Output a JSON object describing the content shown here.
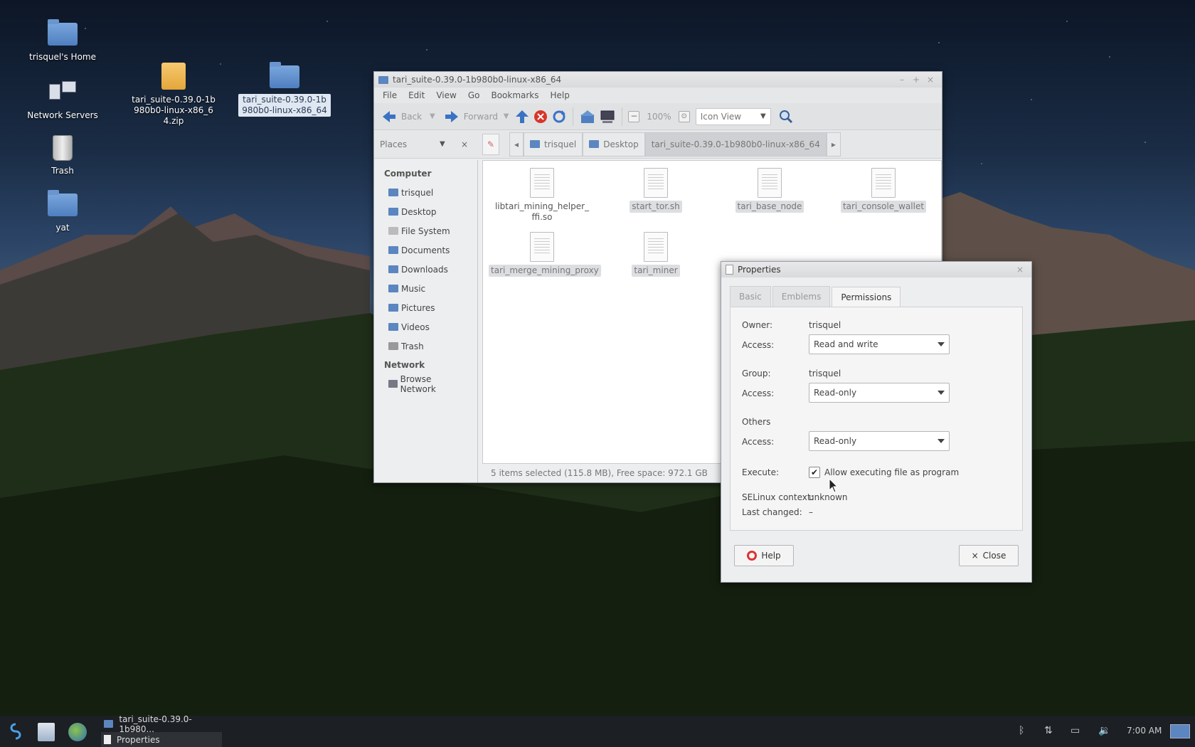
{
  "desktop": {
    "icons": [
      {
        "label": "trisquel's Home"
      },
      {
        "label": "Network Servers"
      },
      {
        "label": "Trash"
      },
      {
        "label": "yat"
      },
      {
        "label": "tari_suite-0.39.0-1b980b0-linux-x86_64.zip"
      },
      {
        "label": "tari_suite-0.39.0-1b980b0-linux-x86_64"
      }
    ]
  },
  "filemanager": {
    "title": "tari_suite-0.39.0-1b980b0-linux-x86_64",
    "menu": [
      "File",
      "Edit",
      "View",
      "Go",
      "Bookmarks",
      "Help"
    ],
    "toolbar": {
      "back": "Back",
      "forward": "Forward",
      "zoom": "100%",
      "view_mode": "Icon View"
    },
    "places_label": "Places",
    "breadcrumbs": [
      "trisquel",
      "Desktop",
      "tari_suite-0.39.0-1b980b0-linux-x86_64"
    ],
    "sidebar": {
      "computer_heading": "Computer",
      "computer_items": [
        "trisquel",
        "Desktop",
        "File System",
        "Documents",
        "Downloads",
        "Music",
        "Pictures",
        "Videos",
        "Trash"
      ],
      "network_heading": "Network",
      "network_items": [
        "Browse Network"
      ]
    },
    "files": [
      {
        "name": "libtari_mining_helper_ffi.so",
        "selected": false
      },
      {
        "name": "start_tor.sh",
        "selected": true
      },
      {
        "name": "tari_base_node",
        "selected": true
      },
      {
        "name": "tari_console_wallet",
        "selected": true
      },
      {
        "name": "tari_merge_mining_proxy",
        "selected": true
      },
      {
        "name": "tari_miner",
        "selected": true
      }
    ],
    "status": "5 items selected (115.8 MB), Free space: 972.1 GB"
  },
  "properties": {
    "title": "Properties",
    "tabs": [
      "Basic",
      "Emblems",
      "Permissions"
    ],
    "active_tab": "Permissions",
    "owner_label": "Owner:",
    "owner": "trisquel",
    "access_label": "Access:",
    "owner_access": "Read and write",
    "group_label": "Group:",
    "group": "trisquel",
    "group_access": "Read-only",
    "others_label": "Others",
    "others_access": "Read-only",
    "execute_label": "Execute:",
    "execute_text": "Allow executing file as program",
    "execute_checked": true,
    "selinux_label": "SELinux context:",
    "selinux": "unknown",
    "last_changed_label": "Last changed:",
    "last_changed": "–",
    "help_button": "Help",
    "close_button": "Close"
  },
  "taskbar": {
    "tasks": [
      "tari_suite-0.39.0-1b980...",
      "Properties"
    ],
    "clock": "7:00 AM"
  }
}
